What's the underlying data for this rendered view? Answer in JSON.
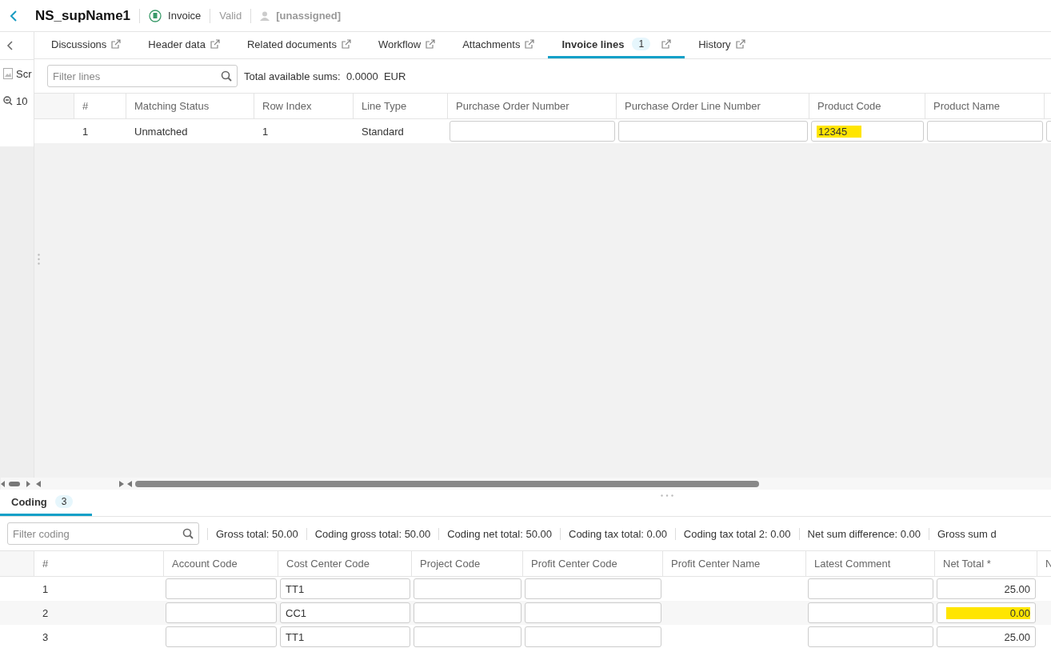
{
  "header": {
    "title": "NS_supName1",
    "doc_type": "Invoice",
    "status": "Valid",
    "assignee": "[unassigned]"
  },
  "side_panel": {
    "items": [
      {
        "kind": "image",
        "label": "Scr"
      },
      {
        "kind": "zoom",
        "label": "10"
      }
    ]
  },
  "tabs": [
    {
      "label": "Discussions",
      "selected": false
    },
    {
      "label": "Header data",
      "selected": false
    },
    {
      "label": "Related documents",
      "selected": false
    },
    {
      "label": "Workflow",
      "selected": false
    },
    {
      "label": "Attachments",
      "selected": false
    },
    {
      "label": "Invoice lines",
      "selected": true,
      "count": "1"
    },
    {
      "label": "History",
      "selected": false
    }
  ],
  "lines": {
    "filter": {
      "placeholder": "Filter lines"
    },
    "sums": "Total available sums:  0.0000  EUR",
    "columns": [
      "",
      "#",
      "Matching Status",
      "Row Index",
      "Line Type",
      "Purchase Order Number",
      "Purchase Order Line Number",
      "Product Code",
      "Product Name",
      ""
    ],
    "rows": [
      [
        {
          "kind": "text"
        },
        {
          "kind": "text",
          "value": "1"
        },
        {
          "kind": "text",
          "value": "Unmatched"
        },
        {
          "kind": "text",
          "value": "1"
        },
        {
          "kind": "text",
          "value": "Standard"
        },
        {
          "kind": "input"
        },
        {
          "kind": "input"
        },
        {
          "kind": "input",
          "value": "12345",
          "highlighted": true
        },
        {
          "kind": "input"
        },
        {
          "kind": "input"
        }
      ]
    ]
  },
  "coding": {
    "tab": {
      "label": "Coding",
      "count": "3",
      "selected": true
    },
    "filter": {
      "placeholder": "Filter coding"
    },
    "sums": [
      "Gross total: 50.00",
      "Coding gross total: 50.00",
      "Coding net total: 50.00",
      "Coding tax total: 0.00",
      "Coding tax total 2: 0.00",
      "Net sum difference: 0.00",
      "Gross sum d"
    ],
    "columns": [
      "",
      "#",
      "Account Code",
      "Cost Center Code",
      "Project Code",
      "Profit Center Code",
      "Profit Center Name",
      "Latest Comment",
      "Net Total *",
      "N"
    ],
    "rows": [
      [
        {
          "kind": "text"
        },
        {
          "kind": "text",
          "value": "1"
        },
        {
          "kind": "input"
        },
        {
          "kind": "input",
          "value": "TT1"
        },
        {
          "kind": "input"
        },
        {
          "kind": "input"
        },
        {
          "kind": "text"
        },
        {
          "kind": "input"
        },
        {
          "kind": "number",
          "value": "25.00"
        },
        {
          "kind": "text"
        }
      ],
      [
        {
          "kind": "text"
        },
        {
          "kind": "text",
          "value": "2"
        },
        {
          "kind": "input"
        },
        {
          "kind": "input",
          "value": "CC1"
        },
        {
          "kind": "input"
        },
        {
          "kind": "input"
        },
        {
          "kind": "text"
        },
        {
          "kind": "input"
        },
        {
          "kind": "number",
          "value": "0.00",
          "highlighted": true
        },
        {
          "kind": "text"
        }
      ],
      [
        {
          "kind": "text"
        },
        {
          "kind": "text",
          "value": "3"
        },
        {
          "kind": "input"
        },
        {
          "kind": "input",
          "value": "TT1"
        },
        {
          "kind": "input"
        },
        {
          "kind": "input"
        },
        {
          "kind": "text"
        },
        {
          "kind": "input"
        },
        {
          "kind": "number",
          "value": "25.00"
        },
        {
          "kind": "text"
        }
      ]
    ]
  }
}
